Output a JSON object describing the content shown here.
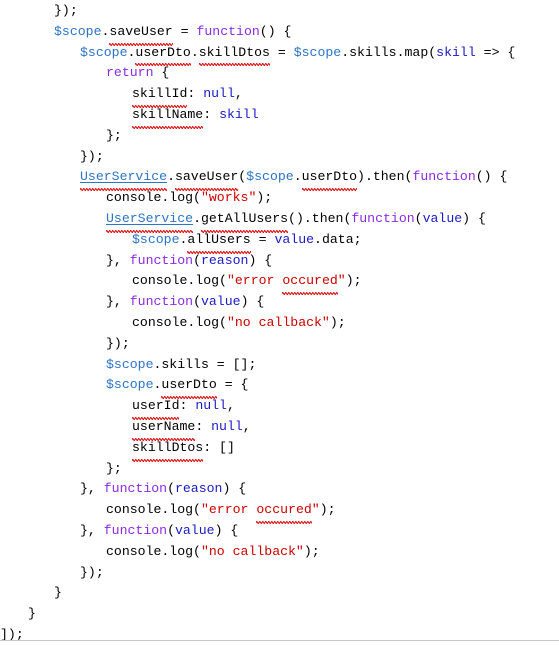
{
  "editor": {
    "language": "javascript",
    "font_family_hint": "monospace",
    "colors": {
      "background": "#ffffff",
      "plain_text": "#000000",
      "scope_variable": "#2E74C4",
      "service_identifier": "#2E74C4",
      "parameter": "#1A1AC4",
      "null_literal": "#1A1AC4",
      "keyword": "#8A2BE2",
      "string_literal": "#CC0000",
      "spellcheck_squiggle": "#E01B1B",
      "bottom_rule": "#c9c9c9"
    },
    "lines": [
      {
        "indent": 54,
        "tokens": [
          {
            "t": "});",
            "c": "t-plain"
          }
        ]
      },
      {
        "indent": 54,
        "tokens": [
          {
            "t": "$scope",
            "c": "t-scope"
          },
          {
            "t": ".",
            "c": "t-plain"
          },
          {
            "t": "saveUser",
            "c": "t-plain",
            "sq": true
          },
          {
            "t": " = ",
            "c": "t-plain"
          },
          {
            "t": "function",
            "c": "t-keyword"
          },
          {
            "t": "() {",
            "c": "t-plain"
          }
        ]
      },
      {
        "indent": 80,
        "tokens": [
          {
            "t": "$scope",
            "c": "t-scope"
          },
          {
            "t": ".",
            "c": "t-plain"
          },
          {
            "t": "userDto",
            "c": "t-plain",
            "sq": true
          },
          {
            "t": ".",
            "c": "t-plain"
          },
          {
            "t": "skillDtos",
            "c": "t-plain",
            "sq": true
          },
          {
            "t": " = ",
            "c": "t-plain"
          },
          {
            "t": "$scope",
            "c": "t-scope"
          },
          {
            "t": ".skills.map(",
            "c": "t-plain"
          },
          {
            "t": "skill",
            "c": "t-param"
          },
          {
            "t": " => {",
            "c": "t-plain"
          }
        ]
      },
      {
        "indent": 106,
        "tokens": [
          {
            "t": "return",
            "c": "t-keyword"
          },
          {
            "t": " {",
            "c": "t-plain"
          }
        ]
      },
      {
        "indent": 132,
        "tokens": [
          {
            "t": "skillId",
            "c": "t-plain",
            "sq": true
          },
          {
            "t": ": ",
            "c": "t-plain"
          },
          {
            "t": "null",
            "c": "t-null"
          },
          {
            "t": ",",
            "c": "t-plain"
          }
        ]
      },
      {
        "indent": 132,
        "tokens": [
          {
            "t": "skillName",
            "c": "t-plain",
            "sq": true
          },
          {
            "t": ": ",
            "c": "t-plain"
          },
          {
            "t": "skill",
            "c": "t-param"
          }
        ]
      },
      {
        "indent": 106,
        "tokens": [
          {
            "t": "};",
            "c": "t-plain"
          }
        ]
      },
      {
        "indent": 80,
        "tokens": [
          {
            "t": "});",
            "c": "t-plain"
          }
        ]
      },
      {
        "indent": 80,
        "tokens": [
          {
            "t": "UserService",
            "c": "t-service",
            "sq": true
          },
          {
            "t": ".",
            "c": "t-plain"
          },
          {
            "t": "saveUser",
            "c": "t-plain",
            "sq": true
          },
          {
            "t": "(",
            "c": "t-plain"
          },
          {
            "t": "$scope",
            "c": "t-scope"
          },
          {
            "t": ".",
            "c": "t-plain"
          },
          {
            "t": "userDto",
            "c": "t-plain",
            "sq": true
          },
          {
            "t": ").then(",
            "c": "t-plain"
          },
          {
            "t": "function",
            "c": "t-keyword"
          },
          {
            "t": "() {",
            "c": "t-plain"
          }
        ]
      },
      {
        "indent": 106,
        "tokens": [
          {
            "t": "console.log(",
            "c": "t-plain"
          },
          {
            "t": "\"works\"",
            "c": "t-string"
          },
          {
            "t": ");",
            "c": "t-plain"
          }
        ]
      },
      {
        "indent": 106,
        "tokens": [
          {
            "t": "UserService",
            "c": "t-service",
            "sq": true
          },
          {
            "t": ".",
            "c": "t-plain"
          },
          {
            "t": "getAllUsers",
            "c": "t-plain",
            "sq": true
          },
          {
            "t": "().then(",
            "c": "t-plain"
          },
          {
            "t": "function",
            "c": "t-keyword"
          },
          {
            "t": "(",
            "c": "t-plain"
          },
          {
            "t": "value",
            "c": "t-param"
          },
          {
            "t": ") {",
            "c": "t-plain"
          }
        ]
      },
      {
        "indent": 132,
        "tokens": [
          {
            "t": "$scope",
            "c": "t-scope"
          },
          {
            "t": ".",
            "c": "t-plain"
          },
          {
            "t": "allUsers",
            "c": "t-plain",
            "sq": true
          },
          {
            "t": " = ",
            "c": "t-plain"
          },
          {
            "t": "value",
            "c": "t-param"
          },
          {
            "t": ".data;",
            "c": "t-plain"
          }
        ]
      },
      {
        "indent": 106,
        "tokens": [
          {
            "t": "}, ",
            "c": "t-plain"
          },
          {
            "t": "function",
            "c": "t-keyword"
          },
          {
            "t": "(",
            "c": "t-plain"
          },
          {
            "t": "reason",
            "c": "t-param"
          },
          {
            "t": ") {",
            "c": "t-plain"
          }
        ]
      },
      {
        "indent": 132,
        "tokens": [
          {
            "t": "console.log(",
            "c": "t-plain"
          },
          {
            "t": "\"error ",
            "c": "t-string"
          },
          {
            "t": "occured",
            "c": "t-string",
            "sq": true
          },
          {
            "t": "\"",
            "c": "t-string"
          },
          {
            "t": ");",
            "c": "t-plain"
          }
        ]
      },
      {
        "indent": 106,
        "tokens": [
          {
            "t": "}, ",
            "c": "t-plain"
          },
          {
            "t": "function",
            "c": "t-keyword"
          },
          {
            "t": "(",
            "c": "t-plain"
          },
          {
            "t": "value",
            "c": "t-param"
          },
          {
            "t": ") {",
            "c": "t-plain"
          }
        ]
      },
      {
        "indent": 132,
        "tokens": [
          {
            "t": "console.log(",
            "c": "t-plain"
          },
          {
            "t": "\"no callback\"",
            "c": "t-string"
          },
          {
            "t": ");",
            "c": "t-plain"
          }
        ]
      },
      {
        "indent": 106,
        "tokens": [
          {
            "t": "});",
            "c": "t-plain"
          }
        ]
      },
      {
        "indent": 106,
        "tokens": [
          {
            "t": "$scope",
            "c": "t-scope"
          },
          {
            "t": ".skills = [];",
            "c": "t-plain"
          }
        ]
      },
      {
        "indent": 106,
        "tokens": [
          {
            "t": "$scope",
            "c": "t-scope"
          },
          {
            "t": ".",
            "c": "t-plain"
          },
          {
            "t": "userDto",
            "c": "t-plain",
            "sq": true
          },
          {
            "t": " = {",
            "c": "t-plain"
          }
        ]
      },
      {
        "indent": 132,
        "tokens": [
          {
            "t": "userId",
            "c": "t-plain",
            "sq": true
          },
          {
            "t": ": ",
            "c": "t-plain"
          },
          {
            "t": "null",
            "c": "t-null"
          },
          {
            "t": ",",
            "c": "t-plain"
          }
        ]
      },
      {
        "indent": 132,
        "tokens": [
          {
            "t": "userName",
            "c": "t-plain",
            "sq": true
          },
          {
            "t": ": ",
            "c": "t-plain"
          },
          {
            "t": "null",
            "c": "t-null"
          },
          {
            "t": ",",
            "c": "t-plain"
          }
        ]
      },
      {
        "indent": 132,
        "tokens": [
          {
            "t": "skillDtos",
            "c": "t-plain",
            "sq": true
          },
          {
            "t": ": []",
            "c": "t-plain"
          }
        ]
      },
      {
        "indent": 106,
        "tokens": [
          {
            "t": "};",
            "c": "t-plain"
          }
        ]
      },
      {
        "indent": 80,
        "tokens": [
          {
            "t": "}, ",
            "c": "t-plain"
          },
          {
            "t": "function",
            "c": "t-keyword"
          },
          {
            "t": "(",
            "c": "t-plain"
          },
          {
            "t": "reason",
            "c": "t-param"
          },
          {
            "t": ") {",
            "c": "t-plain"
          }
        ]
      },
      {
        "indent": 106,
        "tokens": [
          {
            "t": "console.log(",
            "c": "t-plain"
          },
          {
            "t": "\"error ",
            "c": "t-string"
          },
          {
            "t": "occured",
            "c": "t-string",
            "sq": true
          },
          {
            "t": "\"",
            "c": "t-string"
          },
          {
            "t": ");",
            "c": "t-plain"
          }
        ]
      },
      {
        "indent": 80,
        "tokens": [
          {
            "t": "}, ",
            "c": "t-plain"
          },
          {
            "t": "function",
            "c": "t-keyword"
          },
          {
            "t": "(",
            "c": "t-plain"
          },
          {
            "t": "value",
            "c": "t-param"
          },
          {
            "t": ") {",
            "c": "t-plain"
          }
        ]
      },
      {
        "indent": 106,
        "tokens": [
          {
            "t": "console.log(",
            "c": "t-plain"
          },
          {
            "t": "\"no callback\"",
            "c": "t-string"
          },
          {
            "t": ");",
            "c": "t-plain"
          }
        ]
      },
      {
        "indent": 80,
        "tokens": [
          {
            "t": "});",
            "c": "t-plain"
          }
        ]
      },
      {
        "indent": 54,
        "tokens": [
          {
            "t": "}",
            "c": "t-plain"
          }
        ]
      },
      {
        "indent": 28,
        "tokens": [
          {
            "t": "}",
            "c": "t-plain"
          }
        ]
      },
      {
        "indent": 0,
        "tokens": [
          {
            "t": "]);",
            "c": "t-plain"
          }
        ]
      }
    ]
  }
}
